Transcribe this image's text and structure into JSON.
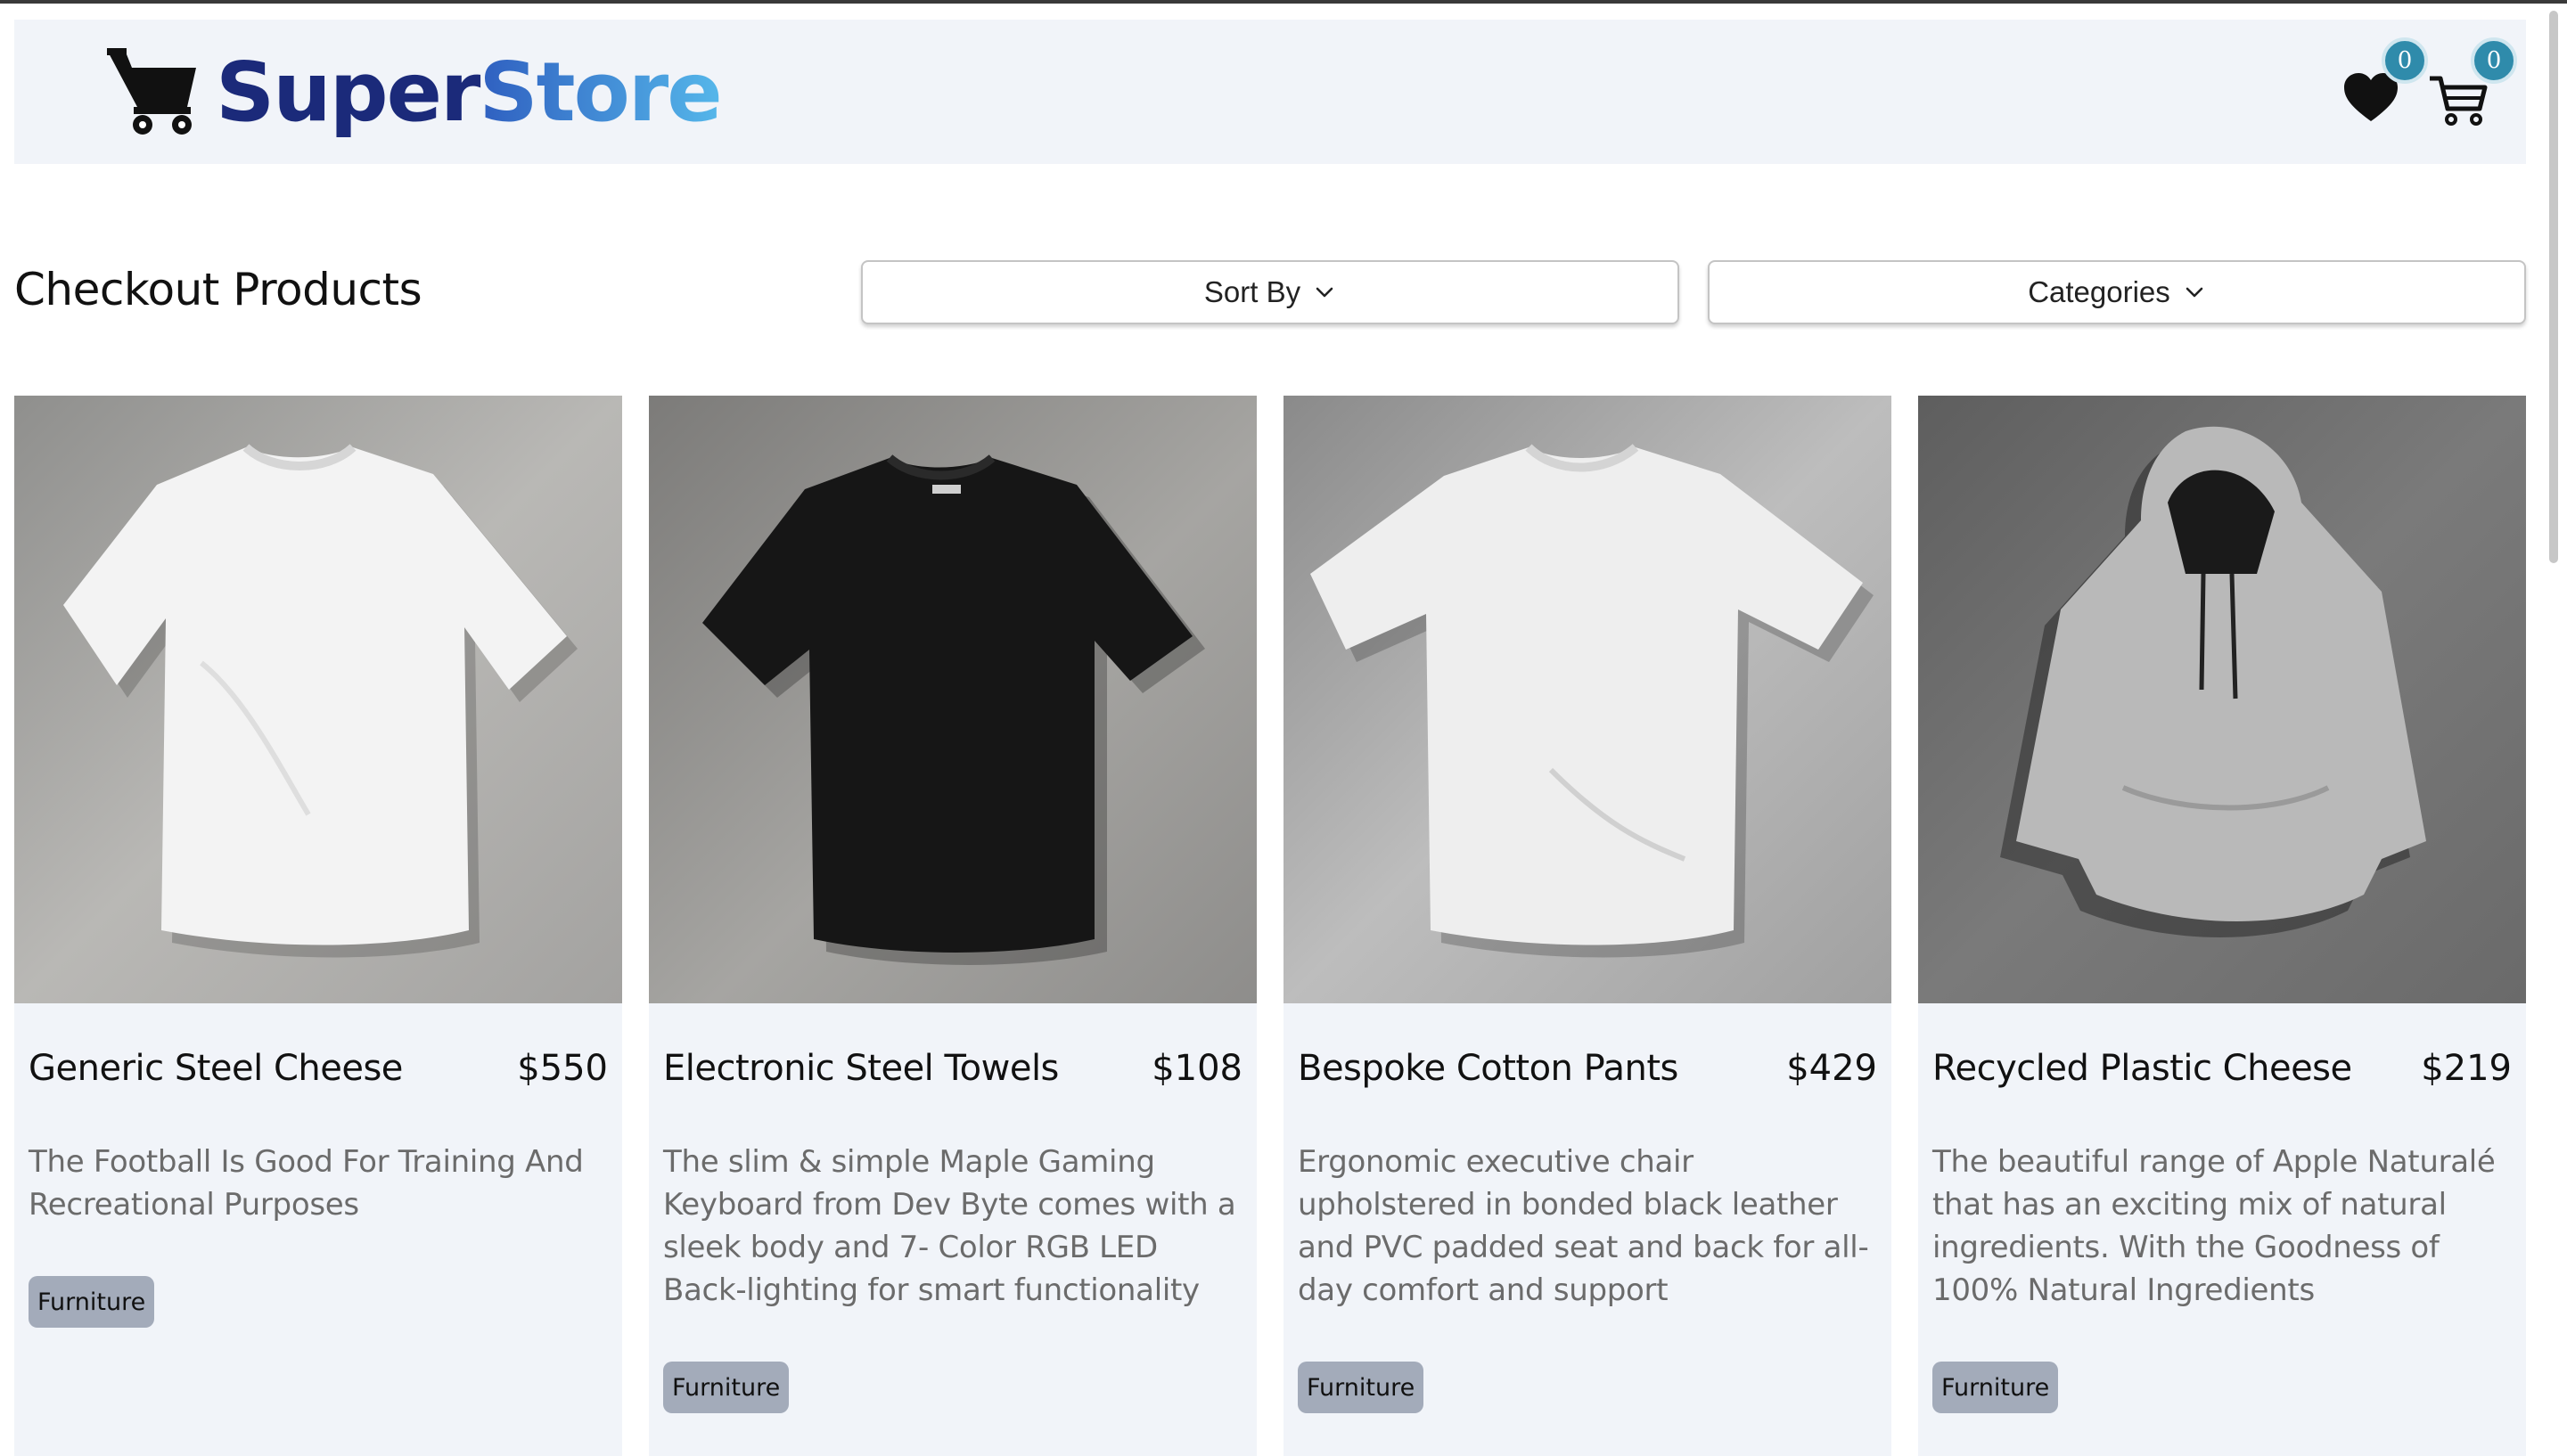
{
  "brand": {
    "part1": "Super",
    "part2": "Store"
  },
  "header": {
    "favorites_count": "0",
    "cart_count": "0"
  },
  "toolbar": {
    "title": "Checkout Products",
    "sort_label": "Sort By",
    "categories_label": "Categories"
  },
  "products": [
    {
      "name": "Generic Steel Cheese",
      "price": "$550",
      "description": "The Football Is Good For Training And Recreational Purposes",
      "tag": "Furniture",
      "image": "white-tshirt"
    },
    {
      "name": "Electronic Steel Towels",
      "price": "$108",
      "description": "The slim & simple Maple Gaming Keyboard from Dev Byte comes with a sleek body and 7- Color RGB LED Back-lighting for smart functionality",
      "tag": "Furniture",
      "image": "black-tshirt"
    },
    {
      "name": "Bespoke Cotton Pants",
      "price": "$429",
      "description": "Ergonomic executive chair upholstered in bonded black leather and PVC padded seat and back for all-day comfort and support",
      "tag": "Furniture",
      "image": "white-tshirt"
    },
    {
      "name": "Recycled Plastic Cheese",
      "price": "$219",
      "description": "The beautiful range of Apple Naturalé that has an exciting mix of natural ingredients. With the Goodness of 100% Natural Ingredients",
      "tag": "Furniture",
      "image": "grey-hoodie"
    }
  ],
  "colors": {
    "brand_dark": "#1b2a7a",
    "brand_light": "#55b7ea",
    "badge": "#2f8bab",
    "card_bg": "#f1f4f9",
    "tag_bg": "#a3abba"
  }
}
